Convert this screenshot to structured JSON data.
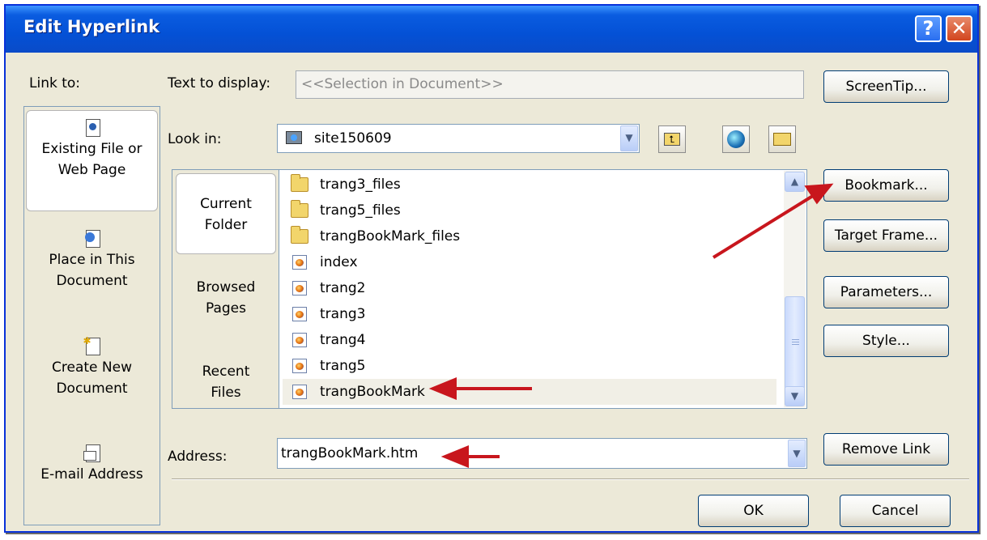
{
  "window": {
    "title": "Edit Hyperlink"
  },
  "title_buttons": {
    "help": "?",
    "close": "✕"
  },
  "link_to": {
    "label": "Link to:",
    "items": [
      {
        "line1": "Existing File or",
        "line2": "Web Page",
        "icon": "existing-file-icon"
      },
      {
        "line1": "Place in This",
        "line2": "Document",
        "icon": "place-in-document-icon"
      },
      {
        "line1": "Create New",
        "line2": "Document",
        "icon": "create-new-document-icon"
      },
      {
        "line1": "E-mail Address",
        "line2": "",
        "icon": "email-address-icon"
      }
    ]
  },
  "text_to_display": {
    "label": "Text to display:",
    "value": "<<Selection in Document>>"
  },
  "look_in": {
    "label": "Look in:",
    "value": "site150609"
  },
  "places": [
    {
      "line1": "Current",
      "line2": "Folder"
    },
    {
      "line1": "Browsed",
      "line2": "Pages"
    },
    {
      "line1": "Recent",
      "line2": "Files"
    }
  ],
  "files": [
    {
      "name": "trang3_files",
      "type": "folder"
    },
    {
      "name": "trang5_files",
      "type": "folder"
    },
    {
      "name": "trangBookMark_files",
      "type": "folder"
    },
    {
      "name": "index",
      "type": "htm"
    },
    {
      "name": "trang2",
      "type": "htm"
    },
    {
      "name": "trang3",
      "type": "htm"
    },
    {
      "name": "trang4",
      "type": "htm"
    },
    {
      "name": "trang5",
      "type": "htm"
    },
    {
      "name": "trangBookMark",
      "type": "htm",
      "selected": true
    }
  ],
  "address": {
    "label": "Address:",
    "value": "trangBookMark.htm"
  },
  "buttons": {
    "screentip": "ScreenTip...",
    "bookmark": "Bookmark...",
    "target_frame": "Target Frame...",
    "parameters": "Parameters...",
    "style": "Style...",
    "remove_link": "Remove Link",
    "ok": "OK",
    "cancel": "Cancel"
  },
  "colors": {
    "titlebar": "#0451d6",
    "dialog_bg": "#ece9d8",
    "annotation_arrow": "#c8161d"
  }
}
